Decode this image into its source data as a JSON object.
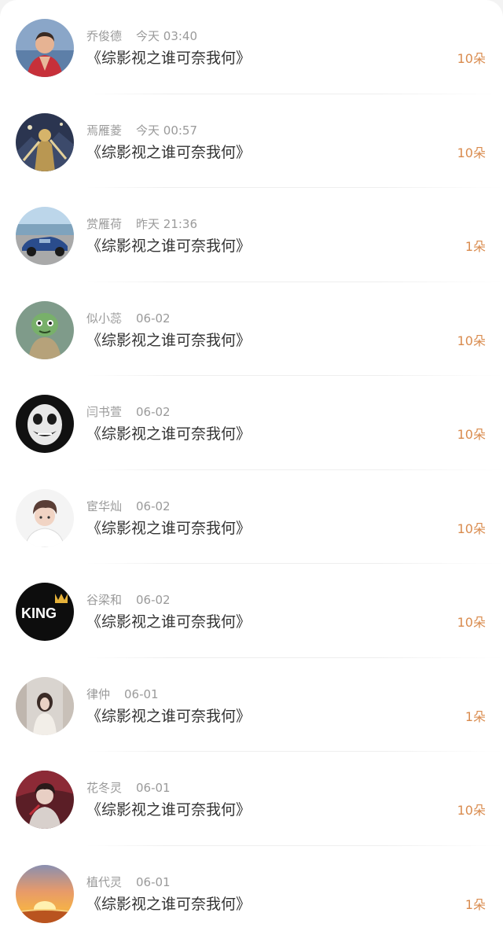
{
  "accent_color": "#d98b4e",
  "records": [
    {
      "name": "乔俊德",
      "time": "今天 03:40",
      "book": "《综影视之谁可奈我何》",
      "gift": "10朵",
      "avatar": "avatar-icon-person-red-shirt"
    },
    {
      "name": "焉雁菱",
      "time": "今天 00:57",
      "book": "《综影视之谁可奈我何》",
      "gift": "10朵",
      "avatar": "avatar-icon-armored-hero"
    },
    {
      "name": "赏雁荷",
      "time": "昨天 21:36",
      "book": "《综影视之谁可奈我何》",
      "gift": "1朵",
      "avatar": "avatar-icon-blue-car"
    },
    {
      "name": "似小蕊",
      "time": "06-02",
      "book": "《综影视之谁可奈我何》",
      "gift": "10朵",
      "avatar": "avatar-icon-green-creature"
    },
    {
      "name": "闫书萱",
      "time": "06-02",
      "book": "《综影视之谁可奈我何》",
      "gift": "10朵",
      "avatar": "avatar-icon-joker-face"
    },
    {
      "name": "宦华灿",
      "time": "06-02",
      "book": "《综影视之谁可奈我何》",
      "gift": "10朵",
      "avatar": "avatar-icon-anime-boy"
    },
    {
      "name": "谷梁和",
      "time": "06-02",
      "book": "《综影视之谁可奈我何》",
      "gift": "10朵",
      "avatar": "avatar-icon-king-crown",
      "avatar_text": "KING"
    },
    {
      "name": "律仲",
      "time": "06-01",
      "book": "《综影视之谁可奈我何》",
      "gift": "1朵",
      "avatar": "avatar-icon-girl-photo"
    },
    {
      "name": "花冬灵",
      "time": "06-01",
      "book": "《综影视之谁可奈我何》",
      "gift": "10朵",
      "avatar": "avatar-icon-red-figure"
    },
    {
      "name": "植代灵",
      "time": "06-01",
      "book": "《综影视之谁可奈我何》",
      "gift": "1朵",
      "avatar": "avatar-icon-sunset"
    }
  ]
}
